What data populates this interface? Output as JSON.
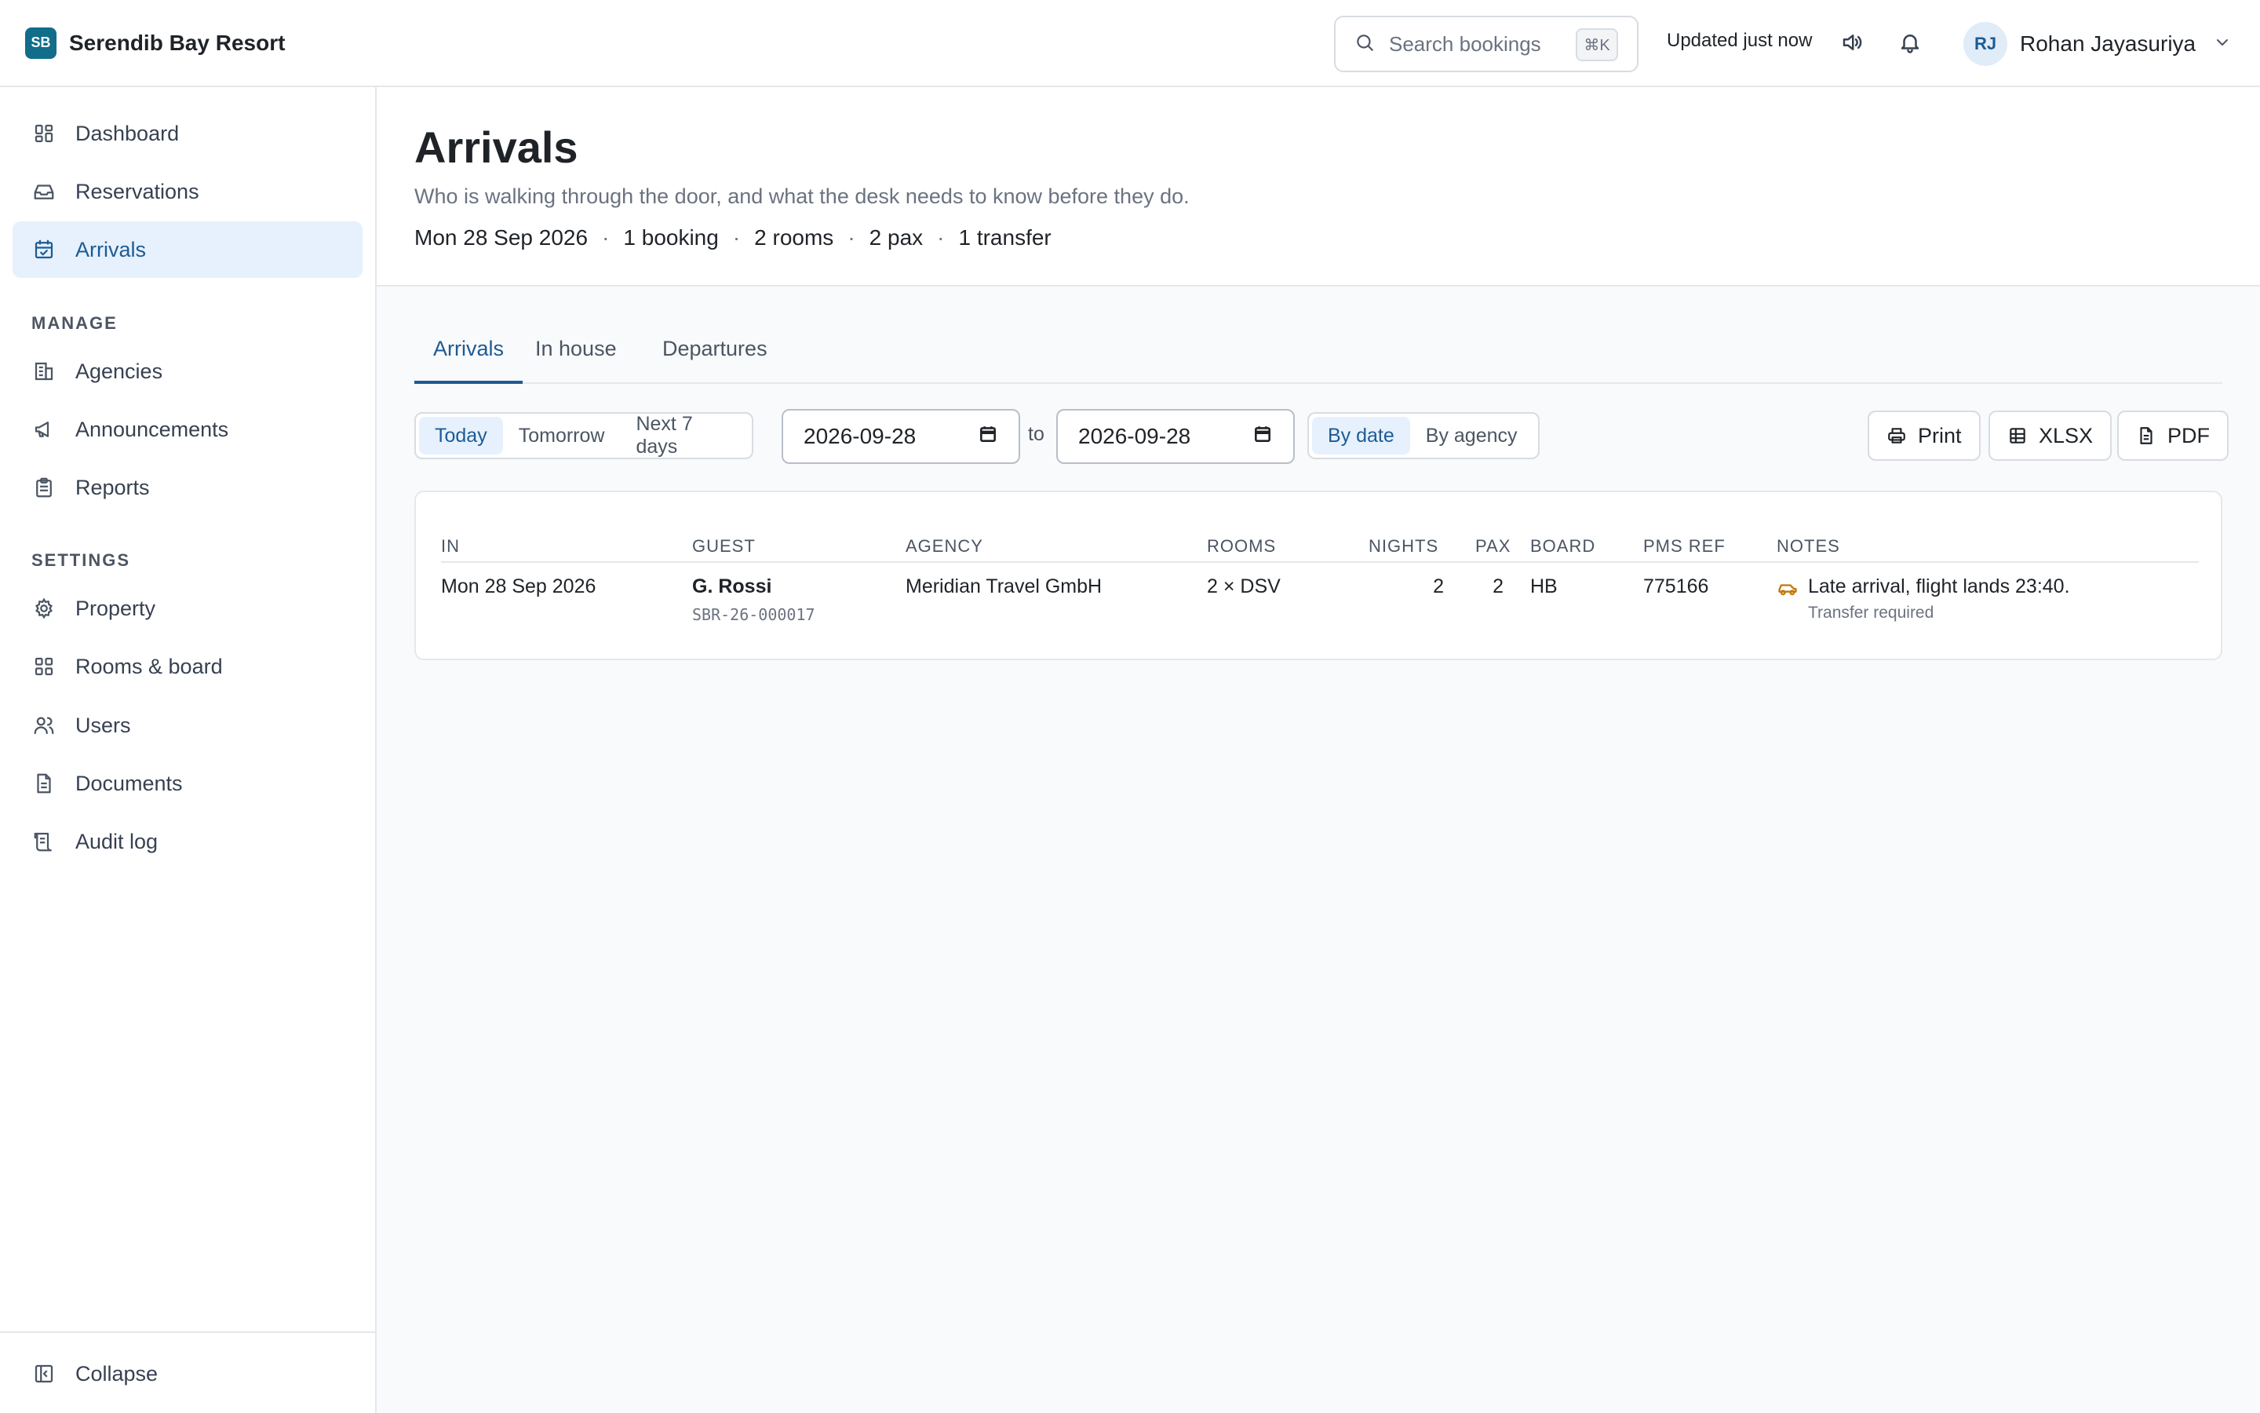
{
  "brand": {
    "logo": "SB",
    "name": "Serendib Bay Resort"
  },
  "topbar": {
    "search_placeholder": "Search bookings",
    "search_shortcut": "⌘K",
    "updated": "Updated just now",
    "user_initials": "RJ",
    "user_name": "Rohan Jayasuriya"
  },
  "sidebar": {
    "main_items": [
      {
        "label": "Dashboard",
        "icon": "dashboard-icon"
      },
      {
        "label": "Reservations",
        "icon": "inbox-icon"
      },
      {
        "label": "Arrivals",
        "icon": "calendar-check-icon",
        "active": true
      }
    ],
    "manage_title": "MANAGE",
    "manage_items": [
      {
        "label": "Agencies",
        "icon": "building-icon"
      },
      {
        "label": "Announcements",
        "icon": "megaphone-icon"
      },
      {
        "label": "Reports",
        "icon": "clipboard-icon"
      }
    ],
    "settings_title": "SETTINGS",
    "settings_items": [
      {
        "label": "Property",
        "icon": "gear-icon"
      },
      {
        "label": "Rooms & board",
        "icon": "grid-icon"
      },
      {
        "label": "Users",
        "icon": "users-icon"
      },
      {
        "label": "Documents",
        "icon": "document-icon"
      },
      {
        "label": "Audit log",
        "icon": "scroll-icon"
      }
    ],
    "collapse_label": "Collapse"
  },
  "header": {
    "title": "Arrivals",
    "subtitle": "Who is walking through the door, and what the desk needs to know before they do.",
    "meta": [
      "Mon 28 Sep 2026",
      "1 booking",
      "2 rooms",
      "2 pax",
      "1 transfer"
    ]
  },
  "tabs": [
    {
      "label": "Arrivals",
      "active": true
    },
    {
      "label": "In house"
    },
    {
      "label": "Departures"
    }
  ],
  "filters": {
    "range_options": [
      {
        "label": "Today",
        "active": true
      },
      {
        "label": "Tomorrow"
      },
      {
        "label": "Next 7 days"
      }
    ],
    "date_from": "2026-09-28",
    "to_label": "to",
    "date_to": "2026-09-28",
    "group_options": [
      {
        "label": "By date",
        "active": true
      },
      {
        "label": "By agency"
      }
    ]
  },
  "actions": {
    "print": "Print",
    "xlsx": "XLSX",
    "pdf": "PDF"
  },
  "table": {
    "columns": [
      "IN",
      "GUEST",
      "AGENCY",
      "ROOMS",
      "NIGHTS",
      "PAX",
      "BOARD",
      "PMS REF",
      "NOTES"
    ],
    "rows": [
      {
        "in": "Mon 28 Sep 2026",
        "guest": "G. Rossi",
        "booking_ref": "SBR-26-000017",
        "agency": "Meridian Travel GmbH",
        "rooms": "2 × DSV",
        "nights": "2",
        "pax": "2",
        "board": "HB",
        "pms_ref": "775166",
        "note": "Late arrival, flight lands 23:40.",
        "note_sub": "Transfer required"
      }
    ]
  },
  "colors": {
    "accent": "#1e5b94",
    "brand": "#116d8a",
    "active_bg": "#e6f1fd",
    "transfer_icon": "#c2780c"
  }
}
